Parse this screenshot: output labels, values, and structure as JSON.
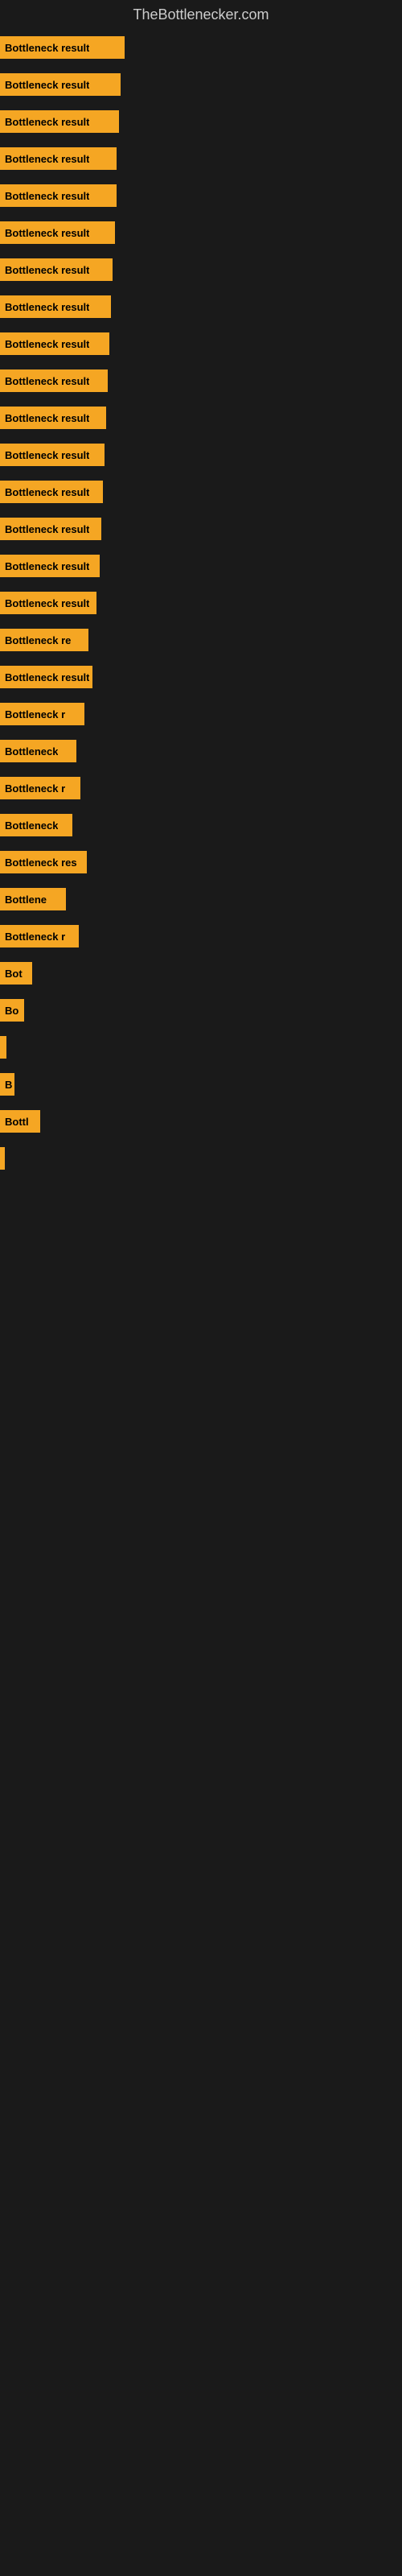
{
  "site": {
    "title": "TheBottlenecker.com"
  },
  "bars": [
    {
      "label": "Bottleneck result",
      "width": 155
    },
    {
      "label": "Bottleneck result",
      "width": 150
    },
    {
      "label": "Bottleneck result",
      "width": 148
    },
    {
      "label": "Bottleneck result",
      "width": 145
    },
    {
      "label": "Bottleneck result",
      "width": 145
    },
    {
      "label": "Bottleneck result",
      "width": 143
    },
    {
      "label": "Bottleneck result",
      "width": 140
    },
    {
      "label": "Bottleneck result",
      "width": 138
    },
    {
      "label": "Bottleneck result",
      "width": 136
    },
    {
      "label": "Bottleneck result",
      "width": 134
    },
    {
      "label": "Bottleneck result",
      "width": 132
    },
    {
      "label": "Bottleneck result",
      "width": 130
    },
    {
      "label": "Bottleneck result",
      "width": 128
    },
    {
      "label": "Bottleneck result",
      "width": 126
    },
    {
      "label": "Bottleneck result",
      "width": 124
    },
    {
      "label": "Bottleneck result",
      "width": 120
    },
    {
      "label": "Bottleneck re",
      "width": 110
    },
    {
      "label": "Bottleneck result",
      "width": 115
    },
    {
      "label": "Bottleneck r",
      "width": 105
    },
    {
      "label": "Bottleneck",
      "width": 95
    },
    {
      "label": "Bottleneck r",
      "width": 100
    },
    {
      "label": "Bottleneck",
      "width": 90
    },
    {
      "label": "Bottleneck res",
      "width": 108
    },
    {
      "label": "Bottlene",
      "width": 82
    },
    {
      "label": "Bottleneck r",
      "width": 98
    },
    {
      "label": "Bot",
      "width": 40
    },
    {
      "label": "Bo",
      "width": 30
    },
    {
      "label": "",
      "width": 8
    },
    {
      "label": "B",
      "width": 18
    },
    {
      "label": "Bottl",
      "width": 50
    },
    {
      "label": "",
      "width": 6
    }
  ]
}
